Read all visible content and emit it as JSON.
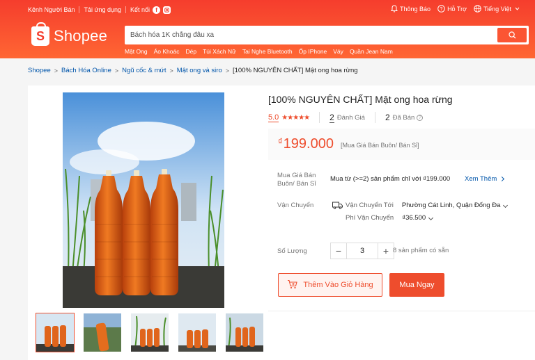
{
  "topbar": {
    "seller_center": "Kênh Người Bán",
    "download_app": "Tải ứng dụng",
    "connect": "Kết nối",
    "notifications": "Thông Báo",
    "help": "Hỗ Trợ",
    "language": "Tiếng Việt"
  },
  "logo": {
    "text": "Shopee"
  },
  "search": {
    "placeholder": "Bách hóa 1K chẳng đâu xa"
  },
  "hotwords": [
    "Mật Ong",
    "Áo Khoác",
    "Dép",
    "Túi Xách Nữ",
    "Tai Nghe Bluetooth",
    "Ốp IPhone",
    "Váy",
    "Quần Jean Nam"
  ],
  "breadcrumb": {
    "items": [
      "Shopee",
      "Bách Hóa Online",
      "Ngũ cốc & mứt",
      "Mật ong và siro"
    ],
    "current": "[100% NGUYÊN CHẤT] Mật ong hoa rừng"
  },
  "product": {
    "title": "[100% NGUYÊN CHẤT] Mật ong hoa rừng",
    "rating": "5.0",
    "stars": "★★★★★",
    "reviews_count": "2",
    "reviews_label": "Đánh Giá",
    "sold_count": "2",
    "sold_label": "Đã Bán",
    "currency": "₫",
    "price": "199.000",
    "price_note": "[Mua Giá Bán Buôn/ Bán Sỉ]",
    "wholesale_label": "Mua Giá Bán Buôn/ Bán Sỉ",
    "wholesale_text": "Mua từ (>=2) sản phẩm chỉ với ₫199.000",
    "see_more": "Xem Thêm",
    "shipping_label": "Vận Chuyển",
    "ship_to_label": "Vận Chuyển Tới",
    "ship_to_value": "Phường Cát Linh, Quận Đống Đa",
    "ship_fee_label": "Phí Vận Chuyển",
    "ship_fee_value": "₫36.500",
    "quantity_label": "Số Lượng",
    "quantity": "3",
    "minus": "−",
    "plus": "+",
    "stock": "8 sản phẩm có sẵn",
    "add_to_cart": "Thêm Vào Giỏ Hàng",
    "buy_now": "Mua Ngay"
  },
  "colors": {
    "brand": "#ee4d2d",
    "link": "#0055aa"
  }
}
